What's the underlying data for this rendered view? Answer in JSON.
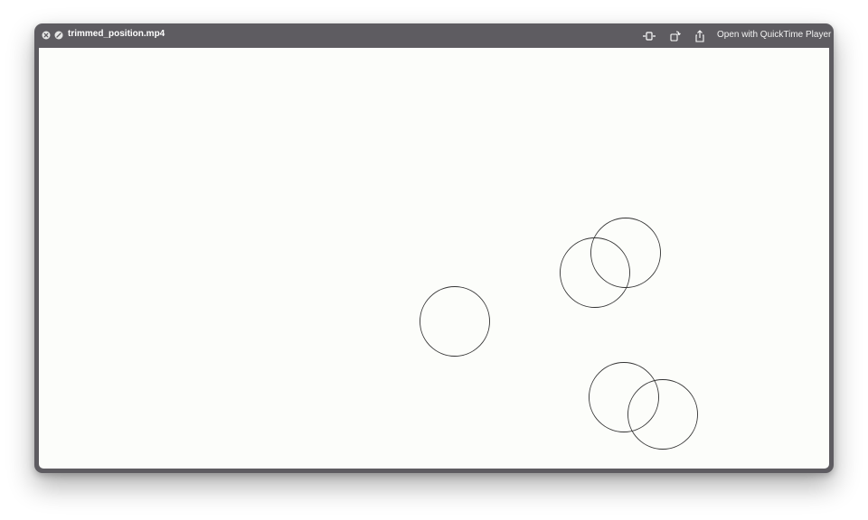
{
  "window": {
    "title": "trimmed_position.mp4",
    "open_with_label": "Open with QuickTime Player"
  },
  "toolbar": {
    "icons": [
      "close-circle-icon",
      "fullscreen-icon",
      "trim-icon",
      "rotate-icon",
      "share-icon"
    ]
  },
  "video": {
    "background": "#fcfdfa",
    "stroke": "#333333",
    "circle_count": 5
  },
  "colors": {
    "titlebar": "#5e5c61",
    "title_text": "#ffffff"
  }
}
